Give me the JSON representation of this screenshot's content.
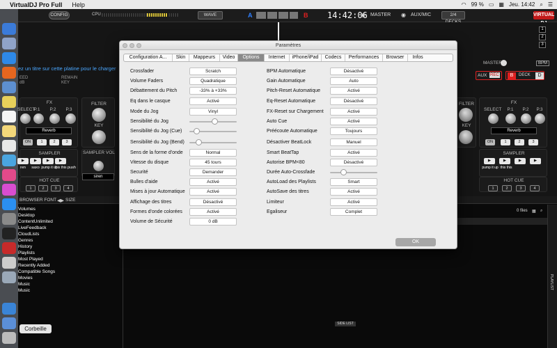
{
  "menubar": {
    "app_name": "VirtualDJ Pro Full",
    "help": "Help",
    "battery": "99 %",
    "clock": "Jeu. 14:42"
  },
  "topbar": {
    "config": "CONFIG",
    "cpu_label": "CPU",
    "wave": "WAVE",
    "deck_a": "A",
    "deck_b": "B",
    "time": "14:42:06",
    "master": "MASTER",
    "aux_mic": "AUX/MIC",
    "decks": "2/4 DECKS",
    "logo": "VIRTUAL DJ",
    "deck_numbers": [
      "1",
      "2",
      "3"
    ]
  },
  "deck_left": {
    "load_msg": "ez un titre sur cette platine pour le charger",
    "speed": "EED",
    "db": "dB",
    "remain": "REMAIN",
    "key": "KEY",
    "fx_title": "FX",
    "fx_labels": [
      "SELECT",
      "P.1",
      "P.2",
      "P.3"
    ],
    "fx_name": "Reverb",
    "on": "ON",
    "nums": [
      "1",
      "2",
      "3"
    ],
    "filter": "FILTER",
    "key2": "KEY",
    "sampler": "SAMPLER",
    "sampler_vol": "SAMPLER VOL",
    "sample_names": [
      "ren",
      "saxo",
      "pump it up",
      "this this",
      "push"
    ],
    "sampler_sel": "siren",
    "hot_cue": "HOT CUE",
    "hc": [
      "1",
      "2",
      "3",
      "4"
    ]
  },
  "deck_right": {
    "master": "MASTER",
    "bpm": "BPM",
    "aux": "AUX",
    "rec": "REC",
    "deck": "DECK",
    "b": "B",
    "d": "D",
    "fx_title": "FX",
    "fx_labels": [
      "SELECT",
      "P.1",
      "P.2",
      "P.3"
    ],
    "fx_name": "Reverb",
    "on": "ON",
    "nums": [
      "1",
      "2",
      "3"
    ],
    "filter": "FILTER",
    "key": "KEY",
    "sampler": "SAMPLER",
    "sample_names": [
      "pump it up",
      "this this"
    ],
    "hot_cue": "HOT CUE",
    "hc": [
      "1",
      "2",
      "3",
      "4"
    ]
  },
  "browser": {
    "font_label": "BROWSER FONT",
    "size_label": "SIZE",
    "files": "0 files",
    "tree": [
      "Volumes",
      "Desktop",
      "ContentUnlimited",
      "LiveFeedback",
      "CloudLists",
      "Genres",
      "History",
      "Playlists",
      "Most Played",
      "Recently Added",
      "Compatible Songs",
      "Movies",
      "Music",
      "Music"
    ],
    "side_list": "SIDE LIST",
    "playlist": "PLAYLIST",
    "trash": "Corbeille"
  },
  "dialog": {
    "title": "Paramètres",
    "tabs": [
      "Configuration A...",
      "Skin",
      "Mappeurs",
      "Video",
      "Options",
      "Internet",
      "iPhone/iPad",
      "Codecs",
      "Performances",
      "Browser",
      "Infos"
    ],
    "active_tab": "Options",
    "left": [
      {
        "label": "Crossfader",
        "value": "Scratch"
      },
      {
        "label": "Volume Faders",
        "value": "Quadratique"
      },
      {
        "label": "Débattement du Pitch",
        "value": "-33% à +33%"
      },
      {
        "label": "Eq dans le casque",
        "value": "Activé"
      },
      {
        "label": "Mode du Jog",
        "value": "Vinyl"
      },
      {
        "label": "Sensibilité du Jog",
        "slider": 0.55
      },
      {
        "label": "Sensibilité du Jog (Cue)",
        "slider": 0.1
      },
      {
        "label": "Sensibilité du Jog (Bend)",
        "slider": 0.15
      },
      {
        "label": "Sens de la forme d'onde",
        "value": "Normal"
      },
      {
        "label": "Vitesse du disque",
        "value": "45 tours"
      },
      {
        "label": "Securité",
        "value": "Demander"
      },
      {
        "label": "Bulles d'aide",
        "value": "Activé"
      },
      {
        "label": "Mises à jour Automatique",
        "value": "Activé"
      },
      {
        "label": "Affichage des titres",
        "value": "Désactivé"
      },
      {
        "label": "Formes d'onde colorées",
        "value": "Activé"
      },
      {
        "label": "Volume de Sécurité",
        "value": "0 dB"
      }
    ],
    "right": [
      {
        "label": "BPM Automatique",
        "value": "Désactivé"
      },
      {
        "label": "Gain Automatique",
        "value": "Auto"
      },
      {
        "label": "Pitch-Reset Automatique",
        "value": "Activé"
      },
      {
        "label": "Eq-Reset Automatique",
        "value": "Désactivé"
      },
      {
        "label": "FX-Reset sur Chargement",
        "value": "Activé"
      },
      {
        "label": "Auto Cue",
        "value": "Activé"
      },
      {
        "label": "Préécoute Automatique",
        "value": "Toujours"
      },
      {
        "label": "Désactiver BeatLock",
        "value": "Manuel"
      },
      {
        "label": "Smart BeatTap",
        "value": "Activé"
      },
      {
        "label": "Autorise BPM<80",
        "value": "Désactivé"
      },
      {
        "label": "Durée Auto-Crossfade",
        "slider": 0.25
      },
      {
        "label": "AutoLoad des Playlists",
        "value": "Smart"
      },
      {
        "label": "AutoSave des titres",
        "value": "Activé"
      },
      {
        "label": "Limiteur",
        "value": "Activé"
      },
      {
        "label": "Egaliseur",
        "value": "Complet"
      }
    ],
    "ok": "OK"
  },
  "colors": {
    "deck_a": "#2f7fff",
    "deck_b": "#e02020",
    "vdj_red": "#c21a1a",
    "active_tab": "#8a8a8a"
  }
}
